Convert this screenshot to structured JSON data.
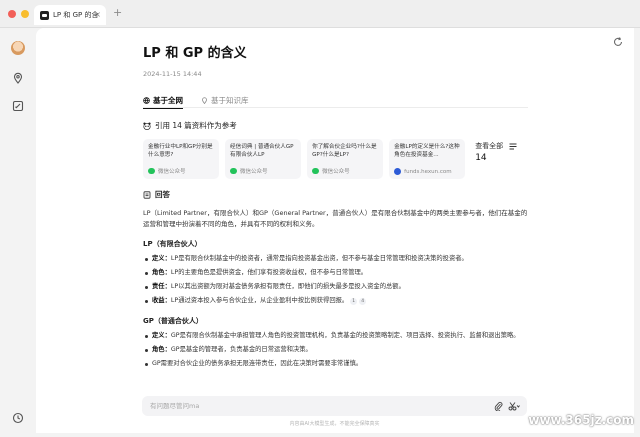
{
  "window": {
    "tab_title": "LP 和 GP 的含",
    "tab_close": "×",
    "new_tab": "+"
  },
  "article": {
    "title": "LP 和 GP 的含义",
    "date": "2024-11-15 14:44"
  },
  "search_tabs": [
    {
      "label": "基于全网",
      "active": true
    },
    {
      "label": "基于知识库",
      "active": false
    }
  ],
  "references": {
    "heading": "引用 14 篇资料作为参考",
    "cards": [
      {
        "title": "金融行业中LP和GP分别是什么意思?",
        "source": "微信公众号",
        "source_icon": "wechat-icon"
      },
      {
        "title": "经信词典 | 普通合伙人GP 有限合伙人LP",
        "source": "微信公众号",
        "source_icon": "wechat-icon"
      },
      {
        "title": "你了解合伙企业吗?什么是GP?什么是LP?",
        "source": "微信公众号",
        "source_icon": "wechat-icon"
      },
      {
        "title": "金融LP的定义是什么?这种角色在投资基金...",
        "source": "funds.hexun.com",
        "source_icon": "hexun-icon"
      }
    ],
    "view_all_label": "查看全部",
    "view_all_count": "14"
  },
  "answer": {
    "heading": "回答",
    "intro": "LP（Limited Partner，有限合伙人）和GP（General Partner，普通合伙人）是有限合伙制基金中的两类主要参与者，他们在基金的运营和管理中扮演着不同的角色，并具有不同的权利和义务。",
    "lp_title": "LP（有限合伙人）",
    "lp_items": [
      {
        "term": "定义：",
        "text": "LP是有限合伙制基金中的投资者，通常是指向投资基金出资，但不参与基金日常管理和投资决策的投资者。"
      },
      {
        "term": "角色：",
        "text": "LP的主要角色是提供资金，他们享有投资收益权，但不参与日常管理。"
      },
      {
        "term": "责任：",
        "text": "LP以其出资额为限对基金债务承担有限责任，即他们的损失最多是投入资金的总额。"
      },
      {
        "term": "收益：",
        "text": "LP通过资本投入参与合伙企业，从企业盈利中按比例获得回报。",
        "cites": [
          "1",
          "4"
        ]
      }
    ],
    "gp_title": "GP（普通合伙人）",
    "gp_items": [
      {
        "term": "定义：",
        "text": "GP是有限合伙制基金中承担管理人角色的投资管理机构，负责基金的投资策略制定、项目选择、投资执行、监督和退出策略。"
      },
      {
        "term": "角色：",
        "text": "GP是基金的管理者，负责基金的日常运营和决策。"
      },
      {
        "term": "",
        "text": "GP需要对合伙企业的债务承担无限连带责任，因此在决策时需要非常谨慎。"
      }
    ]
  },
  "composer": {
    "placeholder": "有问题尽管问ma"
  },
  "footer": {
    "note": "内容由AI大模型生成，不能完全保障真实"
  },
  "watermark": "www.365jz.com"
}
